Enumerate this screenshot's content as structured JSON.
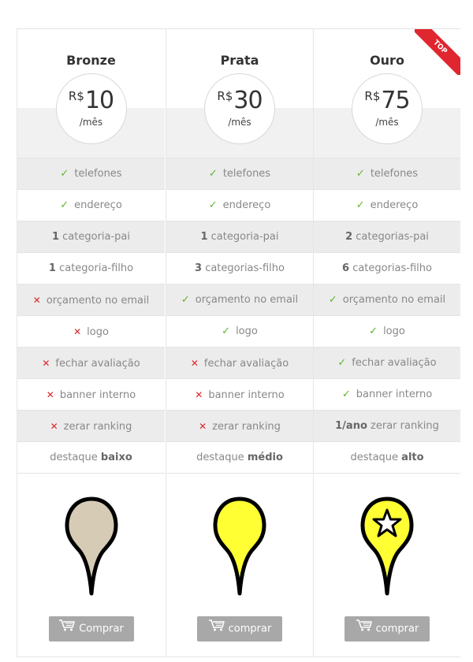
{
  "plans": [
    {
      "name": "Bronze",
      "currency": "R$",
      "amount": "10",
      "period": "/mês",
      "badge": "",
      "features": [
        {
          "icon": "check",
          "text": "telefones"
        },
        {
          "icon": "check",
          "text": "endereço"
        },
        {
          "icon": "none",
          "prefix": "1",
          "text": "categoria-pai"
        },
        {
          "icon": "none",
          "prefix": "1",
          "text": "categoria-filho"
        },
        {
          "icon": "cross",
          "text": "orçamento no email"
        },
        {
          "icon": "cross",
          "text": "logo"
        },
        {
          "icon": "cross",
          "text": "fechar avaliação"
        },
        {
          "icon": "cross",
          "text": "banner interno"
        },
        {
          "icon": "cross",
          "text": "zerar ranking"
        },
        {
          "icon": "none",
          "text": "destaque ",
          "suffix": "baixo"
        }
      ],
      "pin_color": "#d6cbb5",
      "pin_star": false,
      "buy_label": "Comprar"
    },
    {
      "name": "Prata",
      "currency": "R$",
      "amount": "30",
      "period": "/mês",
      "badge": "",
      "features": [
        {
          "icon": "check",
          "text": "telefones"
        },
        {
          "icon": "check",
          "text": "endereço"
        },
        {
          "icon": "none",
          "prefix": "1",
          "text": "categoria-pai"
        },
        {
          "icon": "none",
          "prefix": "3",
          "text": "categorias-filho"
        },
        {
          "icon": "check",
          "text": "orçamento no email"
        },
        {
          "icon": "check",
          "text": "logo"
        },
        {
          "icon": "cross",
          "text": "fechar avaliação"
        },
        {
          "icon": "cross",
          "text": "banner interno"
        },
        {
          "icon": "cross",
          "text": "zerar ranking"
        },
        {
          "icon": "none",
          "text": "destaque ",
          "suffix": "médio"
        }
      ],
      "pin_color": "#ffff33",
      "pin_star": false,
      "buy_label": "comprar"
    },
    {
      "name": "Ouro",
      "currency": "R$",
      "amount": "75",
      "period": "/mês",
      "badge": "TOP",
      "features": [
        {
          "icon": "check",
          "text": "telefones"
        },
        {
          "icon": "check",
          "text": "endereço"
        },
        {
          "icon": "none",
          "prefix": "2",
          "text": "categorias-pai"
        },
        {
          "icon": "none",
          "prefix": "6",
          "text": "categorias-filho"
        },
        {
          "icon": "check",
          "text": "orçamento no email"
        },
        {
          "icon": "check",
          "text": "logo"
        },
        {
          "icon": "check",
          "text": "fechar avaliação"
        },
        {
          "icon": "check",
          "text": "banner interno"
        },
        {
          "icon": "none",
          "prefix": "1/ano",
          "text": "zerar ranking"
        },
        {
          "icon": "none",
          "text": "destaque ",
          "suffix": "alto"
        }
      ],
      "pin_color": "#ffff33",
      "pin_star": true,
      "buy_label": "comprar"
    }
  ],
  "colors": {
    "check": "#62b32a",
    "cross": "#d9262b",
    "badge": "#e0262e",
    "button": "#a8a8a8"
  }
}
